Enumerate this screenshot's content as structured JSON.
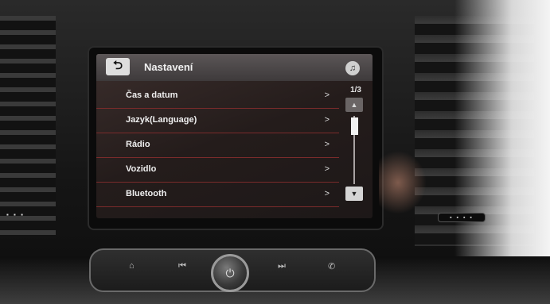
{
  "header": {
    "back_icon": "back-arrow-icon",
    "back_glyph": "⮌",
    "title": "Nastavení",
    "music_icon": "music-note-icon",
    "music_glyph": "♫"
  },
  "menu": {
    "items": [
      {
        "label": "Čas a datum",
        "chevron": ">"
      },
      {
        "label": "Jazyk(Language)",
        "chevron": ">"
      },
      {
        "label": "Rádio",
        "chevron": ">"
      },
      {
        "label": "Vozidlo",
        "chevron": ">"
      },
      {
        "label": "Bluetooth",
        "chevron": ">"
      }
    ]
  },
  "scroll": {
    "page_indicator": "1/3",
    "up_glyph": "▲",
    "down_glyph": "▼"
  },
  "console": {
    "home_glyph": "⌂",
    "prev_glyph": "⏮",
    "power_glyph": "⏻",
    "next_glyph": "⏭",
    "phone_glyph": "✆"
  },
  "colors": {
    "divider": "#7b2b2b",
    "titlebar": "#4a4647",
    "text": "#efefef"
  }
}
